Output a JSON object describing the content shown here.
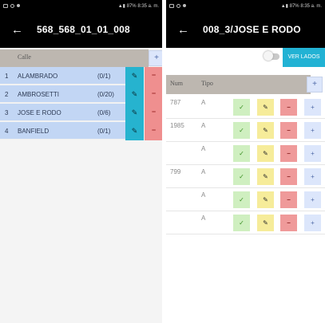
{
  "status_bar": {
    "battery": "87%",
    "time": "8:35 a. m."
  },
  "left": {
    "title": "568_568_01_01_008",
    "header_label": "Calle",
    "add_label": "+",
    "streets": [
      {
        "num": "1",
        "name": "ALAMBRADO",
        "count": "(0/1)"
      },
      {
        "num": "2",
        "name": "AMBROSETTI",
        "count": "(0/20)"
      },
      {
        "num": "3",
        "name": "JOSE E RODO",
        "count": "(0/6)"
      },
      {
        "num": "4",
        "name": "BANFIELD",
        "count": "(0/1)"
      }
    ],
    "edit_label": "✎",
    "delete_label": "−"
  },
  "right": {
    "title": "008_3/JOSE E RODO",
    "ver_lados_label": "VER LADOS",
    "col_num": "Num",
    "col_tipo": "Tipo",
    "add_label": "+",
    "rows": [
      {
        "num": "787",
        "tipo": "A"
      },
      {
        "num": "1985",
        "tipo": "A"
      },
      {
        "num": "",
        "tipo": "A"
      },
      {
        "num": "799",
        "tipo": "A"
      },
      {
        "num": "",
        "tipo": "A"
      },
      {
        "num": "",
        "tipo": "A"
      }
    ],
    "ok_label": "✓",
    "edit_label": "✎",
    "remove_label": "−",
    "plus_label": "+"
  },
  "colors": {
    "edit_blue": "#26b3cf",
    "delete_red": "#ef8f8f",
    "row_blue": "#c2d6f4",
    "header_gray": "#bdb7b0"
  }
}
